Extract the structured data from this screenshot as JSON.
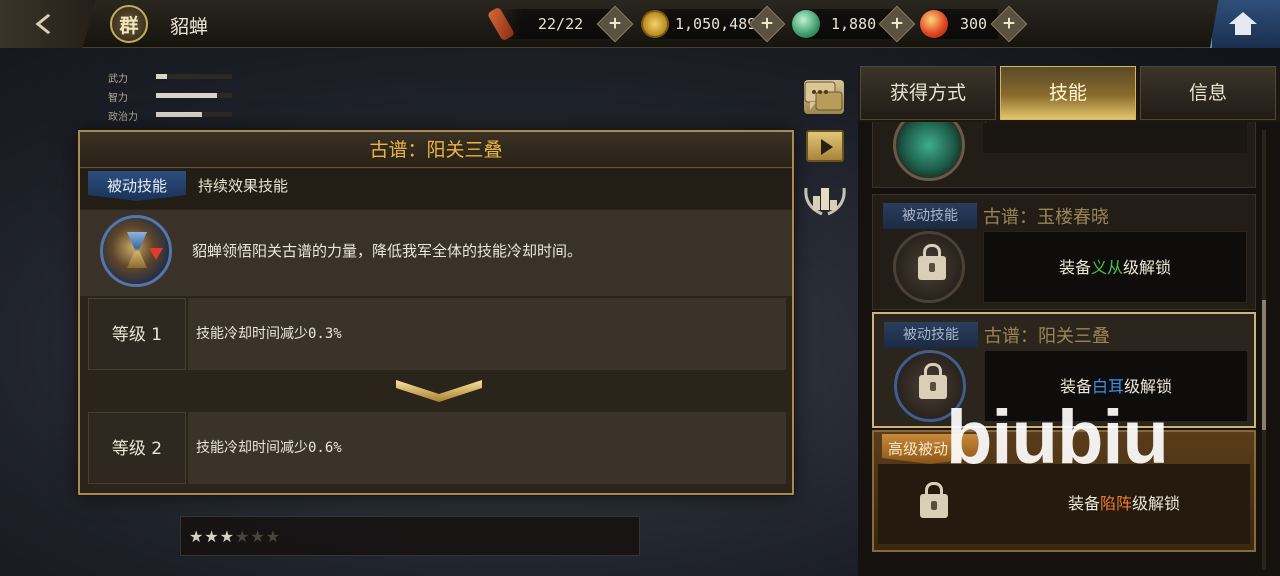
{
  "header": {
    "faction_badge": "群",
    "hero_name": "貂蝉",
    "resources": [
      {
        "name": "stamina",
        "icon": "scroll-icon",
        "value": "22/22"
      },
      {
        "name": "coins",
        "icon": "coin-icon",
        "value": "1,050,489"
      },
      {
        "name": "jade",
        "icon": "jade-icon",
        "value": "1,880"
      },
      {
        "name": "gems",
        "icon": "gem-icon",
        "value": "300"
      }
    ]
  },
  "stats": [
    {
      "label": "武力",
      "level": 0.15
    },
    {
      "label": "智力",
      "level": 0.8
    },
    {
      "label": "政治力",
      "level": 0.6
    }
  ],
  "detail": {
    "title": "古谱：阳关三叠",
    "skill_type": "被动技能",
    "effect_type": "持续效果技能",
    "description": "貂蝉领悟阳关古谱的力量，降低我军全体的技能冷却时间。",
    "levels": [
      {
        "label": "等级 1",
        "text": "技能冷却时间减少0.3%"
      },
      {
        "label": "等级 2",
        "text": "技能冷却时间减少0.6%"
      }
    ]
  },
  "star_rating": {
    "filled": 3,
    "total": 6,
    "filled_text": "★★★",
    "empty_text": "★★★"
  },
  "tabs": [
    {
      "label": "获得方式",
      "active": false
    },
    {
      "label": "技能",
      "active": true
    },
    {
      "label": "信息",
      "active": false
    }
  ],
  "skills": [
    {
      "tag": "被动技能",
      "name": "古谱：玉楼春晓",
      "unlock_pre": "装备",
      "unlock_grade": "义从",
      "unlock_post": "级解锁",
      "grade_color": "#46c24a"
    },
    {
      "tag": "被动技能",
      "name": "古谱：阳关三叠",
      "unlock_pre": "装备",
      "unlock_grade": "白耳",
      "unlock_post": "级解锁",
      "grade_color": "#3f8fe8"
    }
  ],
  "advanced_skill": {
    "tag": "高级被动",
    "unlock_pre": "装备",
    "unlock_grade": "陷阵",
    "unlock_post": "级解锁",
    "grade_color": "#f07a2a"
  },
  "partial_top_card": {
    "text": "/"
  },
  "watermark": "biubiu"
}
